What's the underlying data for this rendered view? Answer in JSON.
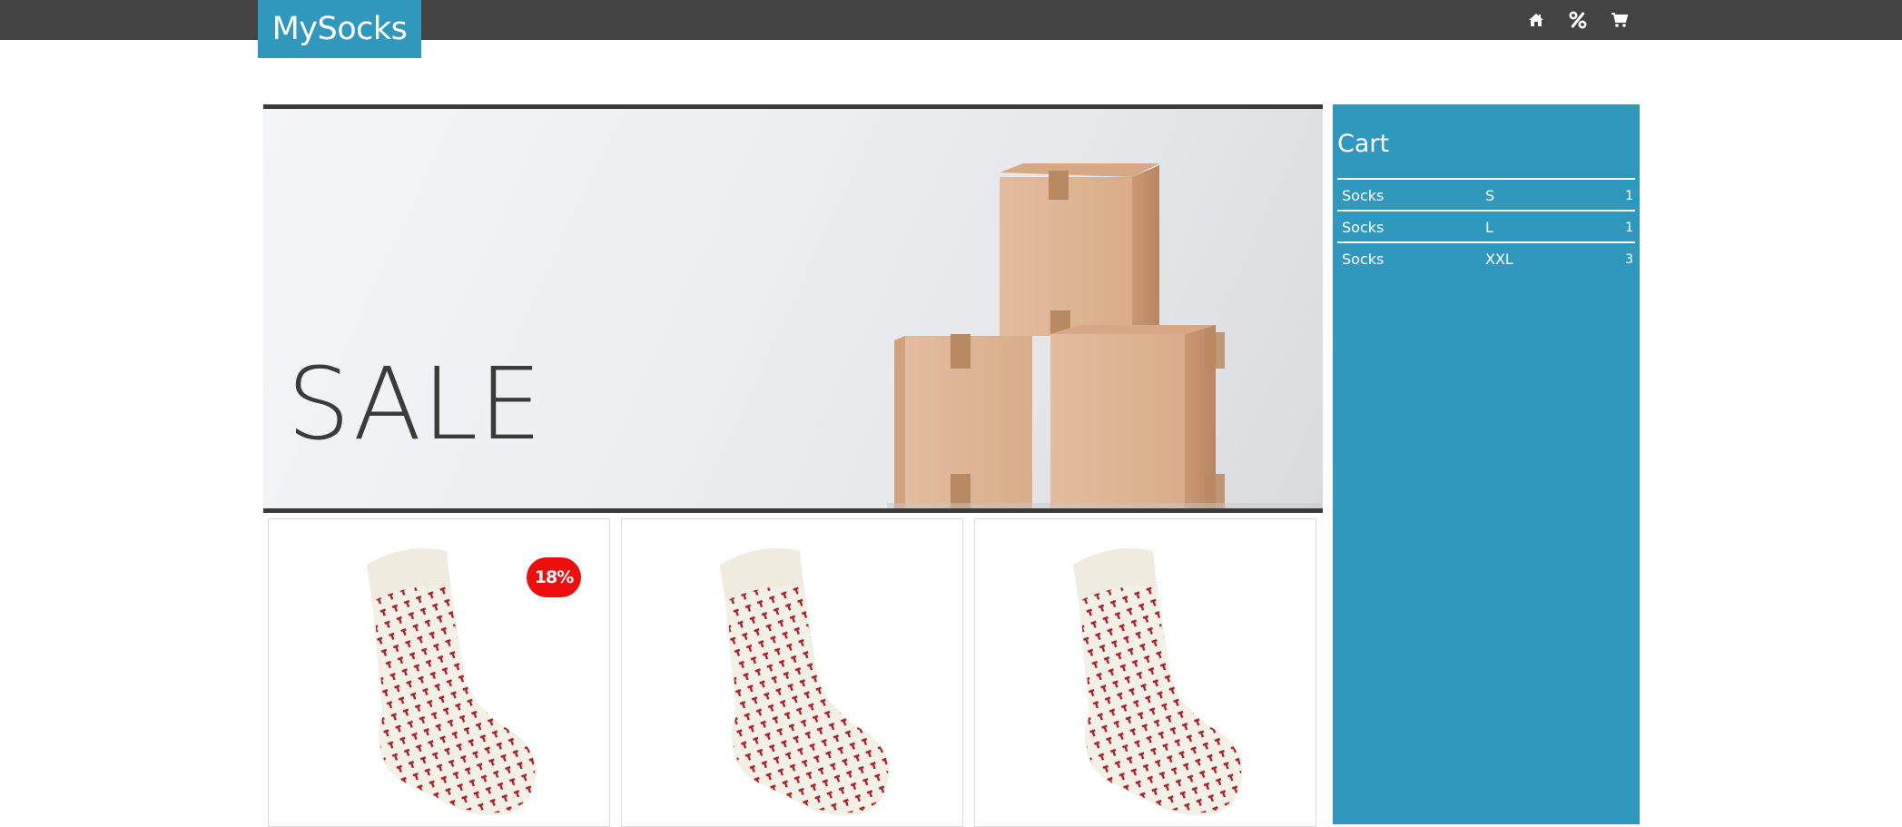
{
  "header": {
    "logo": "MySocks",
    "icons": [
      "home-icon",
      "percent-icon",
      "cart-icon"
    ],
    "bar_color": "#434343",
    "accent_color": "#3198bd"
  },
  "hero": {
    "title": "SALE"
  },
  "products": [
    {
      "discount": "18%"
    },
    {
      "discount": ""
    },
    {
      "discount": ""
    }
  ],
  "cart": {
    "title": "Cart",
    "items": [
      {
        "name": "Socks",
        "size": "S",
        "qty": "1"
      },
      {
        "name": "Socks",
        "size": "L",
        "qty": "1"
      },
      {
        "name": "Socks",
        "size": "XXL",
        "qty": "3"
      }
    ]
  },
  "colors": {
    "badge": "#ee0e0e",
    "sock_base": "#f3f0e6",
    "sock_pattern": "#a8202a"
  }
}
